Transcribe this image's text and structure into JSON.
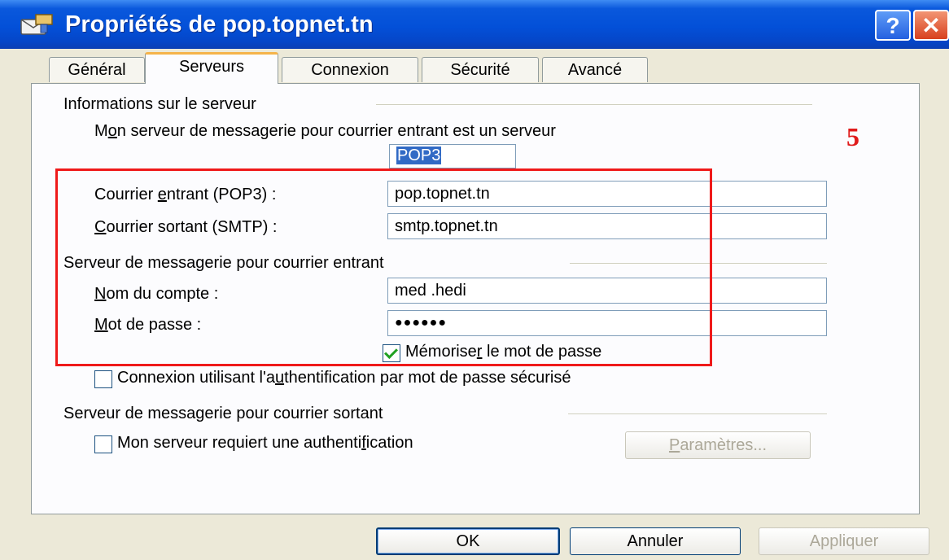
{
  "window": {
    "title": "Propriétés de pop.topnet.tn",
    "help_label": "?",
    "close_label": "✕"
  },
  "tabs": [
    {
      "label": "Général"
    },
    {
      "label": "Serveurs"
    },
    {
      "label": "Connexion"
    },
    {
      "label": "Sécurité"
    },
    {
      "label": "Avancé"
    }
  ],
  "server_info": {
    "heading": "Informations sur le serveur",
    "incoming_type_label_pre": "M",
    "incoming_type_label_u": "o",
    "incoming_type_label_post": "n serveur de messagerie pour courrier entrant est un serveur",
    "incoming_type_value": "POP3",
    "incoming_label_pre": "Courrier ",
    "incoming_label_u": "e",
    "incoming_label_post": "ntrant (POP3) :",
    "incoming_value": "pop.topnet.tn",
    "outgoing_label_u": "C",
    "outgoing_label_post": "ourrier sortant (SMTP) :",
    "outgoing_value": "smtp.topnet.tn"
  },
  "incoming_server": {
    "heading": "Serveur de messagerie pour courrier entrant",
    "account_label_u": "N",
    "account_label_post": "om du compte :",
    "account_value": "med .hedi",
    "password_label_u": "M",
    "password_label_post": "ot de passe :",
    "password_value": "●●●●●●",
    "remember_label_pre": "Mémorise",
    "remember_label_u": "r",
    "remember_label_post": " le mot de passe",
    "remember_checked": true,
    "spa_label_pre": "Connexion utilisant l'a",
    "spa_label_u": "u",
    "spa_label_post": "thentification par mot de passe sécurisé",
    "spa_checked": false
  },
  "outgoing_server": {
    "heading": "Serveur de messagerie pour courrier sortant",
    "auth_label_pre": "Mon serveur requiert une authenti",
    "auth_label_u": "f",
    "auth_label_post": "ication",
    "auth_checked": false,
    "settings_label_u": "P",
    "settings_label_post": "aramètres..."
  },
  "buttons": {
    "ok": "OK",
    "cancel": "Annuler",
    "apply": "Appliquer"
  },
  "annotation": {
    "step_number": "5",
    "color": "#e01b1b"
  }
}
